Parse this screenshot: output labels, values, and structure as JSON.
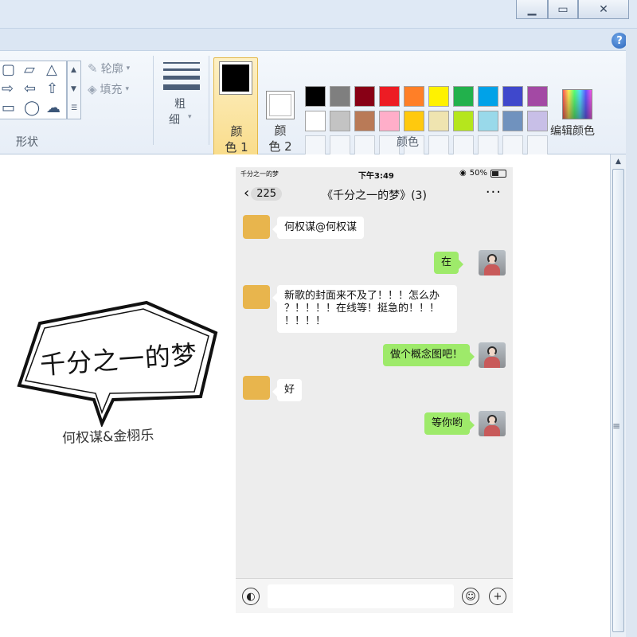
{
  "window": {
    "minimize_icon": "minimize-icon",
    "maximize_icon": "maximize-icon",
    "close_icon": "close-icon",
    "help_label": "?"
  },
  "ribbon": {
    "shapes_group_label": "形状",
    "outline_label": "轮廓",
    "fill_label": "填充",
    "size_label_1": "粗",
    "size_label_2": "细",
    "color1_label_1": "颜",
    "color1_label_2": "色 1",
    "color2_label_1": "颜",
    "color2_label_2": "色 2",
    "colors_group_label": "颜色",
    "edit_colors_label": "编辑颜色",
    "color1_value": "#000000",
    "color2_value": "#ffffff",
    "palette_row1": [
      "#000000",
      "#7f7f7f",
      "#880015",
      "#ed1c24",
      "#ff7f27",
      "#fff200",
      "#22b14c",
      "#00a2e8",
      "#3f48cc",
      "#a349a4"
    ],
    "palette_row2": [
      "#ffffff",
      "#c3c3c3",
      "#b97a57",
      "#ffaec9",
      "#ffc90e",
      "#efe4b0",
      "#b5e61d",
      "#99d9ea",
      "#7092be",
      "#c8bfe7"
    ]
  },
  "canvas": {
    "sticker_title": "千分之一的梦",
    "sticker_subtitle": "何权谋&金栩乐"
  },
  "phone": {
    "status_left": "千分之一的梦",
    "status_time": "下午3:49",
    "status_battery": "50%",
    "back_count": "225",
    "chat_title": "《千分之一的梦》(3)",
    "more_label": "···",
    "messages": [
      {
        "side": "left",
        "text": "何权谋@何权谋"
      },
      {
        "side": "right",
        "text": "在"
      },
      {
        "side": "left",
        "text_line1": "新歌的封面来不及了！！！怎么办",
        "text_line2": "？！！！！在线等！挺急的！！！",
        "text_line3": "！！！！"
      },
      {
        "side": "right",
        "text": "做个概念图吧！"
      },
      {
        "side": "left",
        "text": "好"
      },
      {
        "side": "right",
        "text": "等你哟"
      }
    ]
  }
}
